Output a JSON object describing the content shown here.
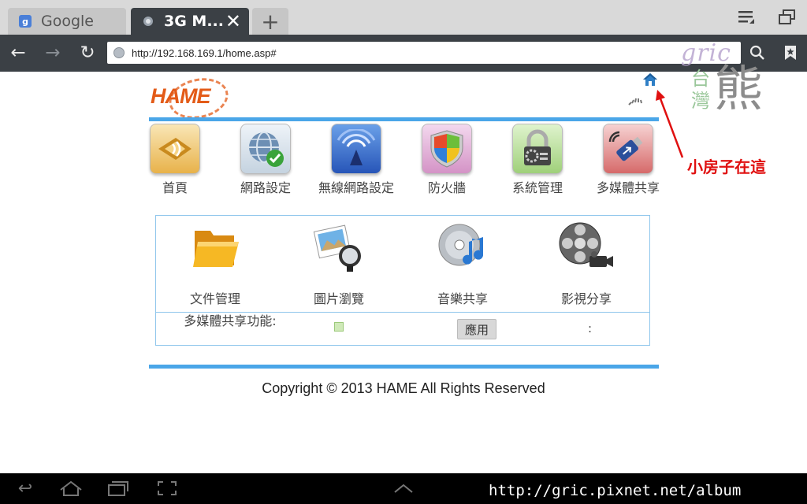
{
  "tabs": [
    {
      "title": "Google",
      "favicon": "google-favicon-icon",
      "active": false
    },
    {
      "title": "3G M...",
      "favicon": "globe-favicon-icon",
      "active": true
    }
  ],
  "toolbar": {
    "url": "http://192.168.169.1/home.asp#"
  },
  "watermark_logo": {
    "latin": "gric",
    "chinese_vertical": "台灣",
    "chinese_big": "熊"
  },
  "page": {
    "brand": "HAME",
    "nav": [
      {
        "label": "首頁",
        "icon": "speaker-home-icon"
      },
      {
        "label": "網路設定",
        "icon": "globe-check-icon"
      },
      {
        "label": "無線網路設定",
        "icon": "wifi-signal-icon"
      },
      {
        "label": "防火牆",
        "icon": "shield-icon"
      },
      {
        "label": "系統管理",
        "icon": "lock-gear-icon"
      },
      {
        "label": "多媒體共享",
        "icon": "usb-drive-icon"
      }
    ],
    "media": [
      {
        "label": "文件管理",
        "icon": "folder-icon"
      },
      {
        "label": "圖片瀏覽",
        "icon": "photo-magnifier-icon"
      },
      {
        "label": "音樂共享",
        "icon": "cd-music-icon"
      },
      {
        "label": "影視分享",
        "icon": "film-reel-icon"
      }
    ],
    "sharing_row": {
      "label": "多媒體共享功能:",
      "checked": true,
      "apply_label": "應用",
      "status": ":"
    },
    "copyright": "Copyright © 2013 HAME All Rights Reserved"
  },
  "annotation": {
    "text": "小房子在這",
    "color": "#e01010"
  },
  "footer_watermark": "http://gric.pixnet.net/album",
  "colors": {
    "accent_blue": "#4aa6e8",
    "brand_orange": "#e35b18",
    "toolbar": "#3b4045"
  }
}
